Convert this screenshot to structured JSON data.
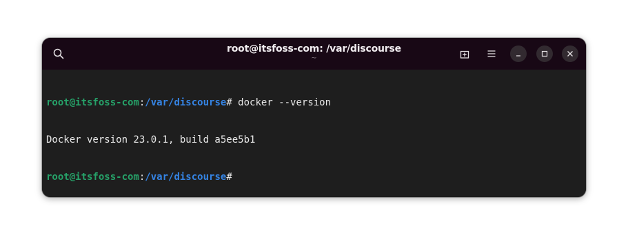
{
  "window": {
    "title": "root@itsfoss-com: /var/discourse",
    "subtitle": "~"
  },
  "toolbar": {
    "search_icon": "search-icon",
    "new_tab_icon": "new-tab-icon",
    "menu_icon": "hamburger-menu-icon",
    "minimize_icon": "minimize-icon",
    "maximize_icon": "maximize-icon",
    "close_icon": "close-icon"
  },
  "terminal": {
    "lines": [
      {
        "user": "root@itsfoss-com",
        "sep": ":",
        "path": "/var/discourse",
        "prompt": "#",
        "command": " docker --version"
      },
      {
        "output": "Docker version 23.0.1, build a5ee5b1"
      },
      {
        "user": "root@itsfoss-com",
        "sep": ":",
        "path": "/var/discourse",
        "prompt": "#",
        "command": ""
      }
    ]
  },
  "colors": {
    "titlebar_bg": "#180815",
    "terminal_bg": "#1e1e1e",
    "prompt_user": "#26a269",
    "prompt_path": "#3584e4",
    "text": "#e8e8e8"
  }
}
